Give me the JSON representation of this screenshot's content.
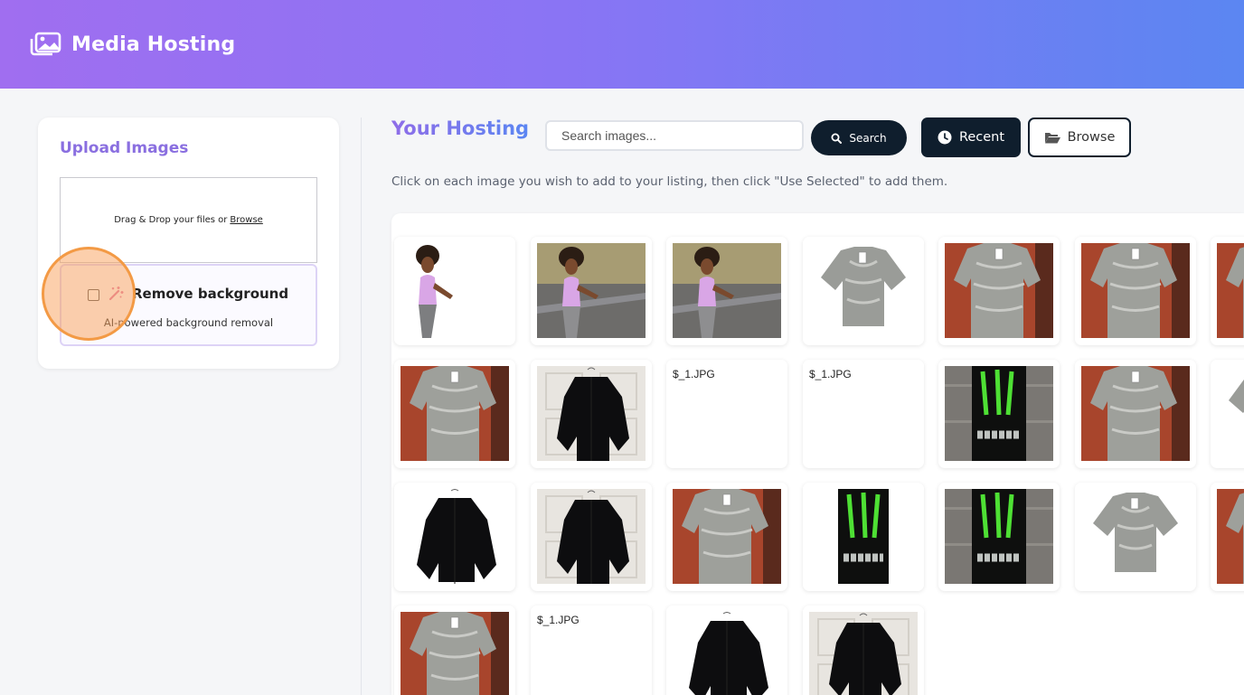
{
  "header": {
    "title": "Media Hosting",
    "logo_icon": "images-icon"
  },
  "upload": {
    "title": "Upload Images",
    "dropzone_text": "Drag & Drop your files or",
    "dropzone_link": "Browse",
    "remove_bg_label": "Remove background",
    "remove_bg_sub": "AI-powered background removal",
    "remove_bg_checked": false
  },
  "main": {
    "title": "Your Hosting",
    "search_placeholder": "Search images...",
    "search_button": "Search",
    "recent_button": "Recent",
    "browse_button": "Browse",
    "hint": "Click on each image you wish to add to your listing, then click \"Use Selected\" to add them."
  },
  "gallery": {
    "rows": [
      [
        "runner-white",
        "runner-street",
        "runner-street",
        "shirt-white",
        "shirt-brick",
        "shirt-brick",
        "shirt-brick"
      ],
      [
        "shirt-brick",
        "jacket-door",
        "broken",
        "broken",
        "monster-can",
        "shirt-brick",
        "shirt-white"
      ],
      [
        "jacket-white",
        "jacket-door",
        "shirt-brick",
        "monster-green",
        "monster-can",
        "shirt-white",
        "shirt-brick"
      ],
      [
        "shirt-brick",
        "broken",
        "jacket-white",
        "jacket-door"
      ]
    ],
    "broken_alt": "$_1.JPG"
  },
  "colors": {
    "header_start": "#a06ef0",
    "header_end": "#5b86f2",
    "dark_button": "#0f1e2d",
    "accent": "#8a6fe0"
  }
}
